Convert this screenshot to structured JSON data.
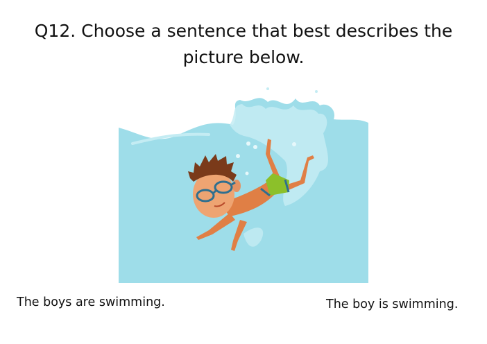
{
  "question": {
    "line1": "Q12. Choose a sentence that best describes the",
    "line2": "picture below."
  },
  "picture": {
    "subject": "boy swimming underwater",
    "colors": {
      "water": "#9edde9",
      "splash": "#c4ecf3",
      "skin": "#e07f45",
      "hair": "#7a3a1a",
      "goggles": "#2f6f8f",
      "shorts": "#8cc02a"
    }
  },
  "options": [
    {
      "label": "The boys are swimming."
    },
    {
      "label": "The boy is swimming."
    }
  ]
}
